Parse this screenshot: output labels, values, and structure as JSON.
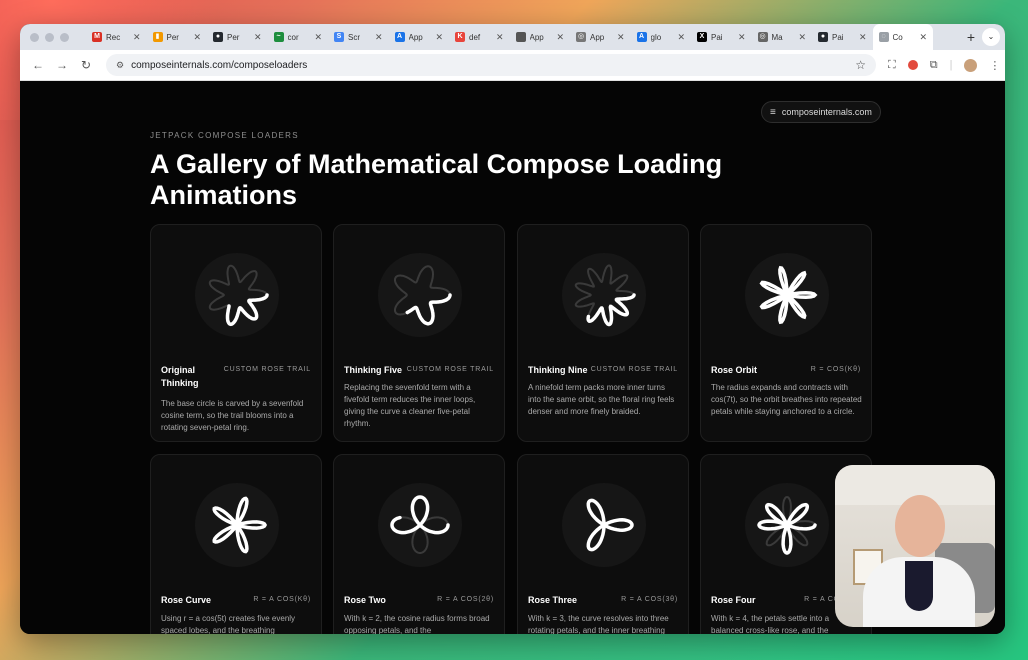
{
  "browser": {
    "tabs": [
      {
        "title": "Rec",
        "icon": "gmail-icon",
        "color": "#d93025",
        "glyph": "M"
      },
      {
        "title": "Per",
        "icon": "analytics-icon",
        "color": "#f29900",
        "glyph": "▮"
      },
      {
        "title": "Per",
        "icon": "github-icon",
        "color": "#24292f",
        "glyph": "●"
      },
      {
        "title": "cor",
        "icon": "activity-icon",
        "color": "#1e8e3e",
        "glyph": "~"
      },
      {
        "title": "Scr",
        "icon": "screen-icon",
        "color": "#4285f4",
        "glyph": "S"
      },
      {
        "title": "App",
        "icon": "appstore-icon",
        "color": "#1a73e8",
        "glyph": "A"
      },
      {
        "title": "def",
        "icon": "def-icon",
        "color": "#e8453c",
        "glyph": "K"
      },
      {
        "title": "App",
        "icon": "apple-icon",
        "color": "#555555",
        "glyph": ""
      },
      {
        "title": "App",
        "icon": "globe-icon",
        "color": "#777777",
        "glyph": "◎"
      },
      {
        "title": "glo",
        "icon": "appstore-icon",
        "color": "#1a73e8",
        "glyph": "A"
      },
      {
        "title": "Pai",
        "icon": "x-icon",
        "color": "#000000",
        "glyph": "X"
      },
      {
        "title": "Ma",
        "icon": "globe-icon",
        "color": "#666666",
        "glyph": "◎"
      },
      {
        "title": "Pai",
        "icon": "github-icon",
        "color": "#24292f",
        "glyph": "●"
      },
      {
        "title": "Co",
        "icon": "site-icon",
        "color": "#9aa0a6",
        "glyph": "◌",
        "active": true
      }
    ],
    "new_tab": "+",
    "url": "composeinternals.com/composeloaders"
  },
  "page": {
    "site_pill": "composeinternals.com",
    "eyebrow": "JETPACK COMPOSE LOADERS",
    "title": "A Gallery of Mathematical Compose Loading Animations",
    "cards": [
      {
        "name": "Original Thinking",
        "tag": "CUSTOM ROSE TRAIL",
        "desc": "The base circle is carved by a sevenfold cosine term, so the trail blooms into a rotating seven-petal ring."
      },
      {
        "name": "Thinking Five",
        "tag": "CUSTOM ROSE TRAIL",
        "desc": "Replacing the sevenfold term with a fivefold term reduces the inner loops, giving the curve a cleaner five-petal rhythm."
      },
      {
        "name": "Thinking Nine",
        "tag": "CUSTOM ROSE TRAIL",
        "desc": "A ninefold term packs more inner turns into the same orbit, so the floral ring feels denser and more finely braided."
      },
      {
        "name": "Rose Orbit",
        "tag": "R = COS(Kθ)",
        "desc": "The radius expands and contracts with cos(7t), so the orbit breathes into repeated petals while staying anchored to a circle."
      },
      {
        "name": "Rose Curve",
        "tag": "R = A COS(Kθ)",
        "desc": "Using r = a cos(5t) creates five evenly spaced lobes, and the breathing"
      },
      {
        "name": "Rose Two",
        "tag": "R = A COS(2θ)",
        "desc": "With k = 2, the cosine radius forms broad opposing petals, and the"
      },
      {
        "name": "Rose Three",
        "tag": "R = A COS(3θ)",
        "desc": "With k = 3, the curve resolves into three rotating petals, and the inner breathing"
      },
      {
        "name": "Rose Four",
        "tag": "R = A COS(4θ)",
        "desc": "With k = 4, the petals settle into a balanced cross-like rose, and the"
      }
    ]
  }
}
